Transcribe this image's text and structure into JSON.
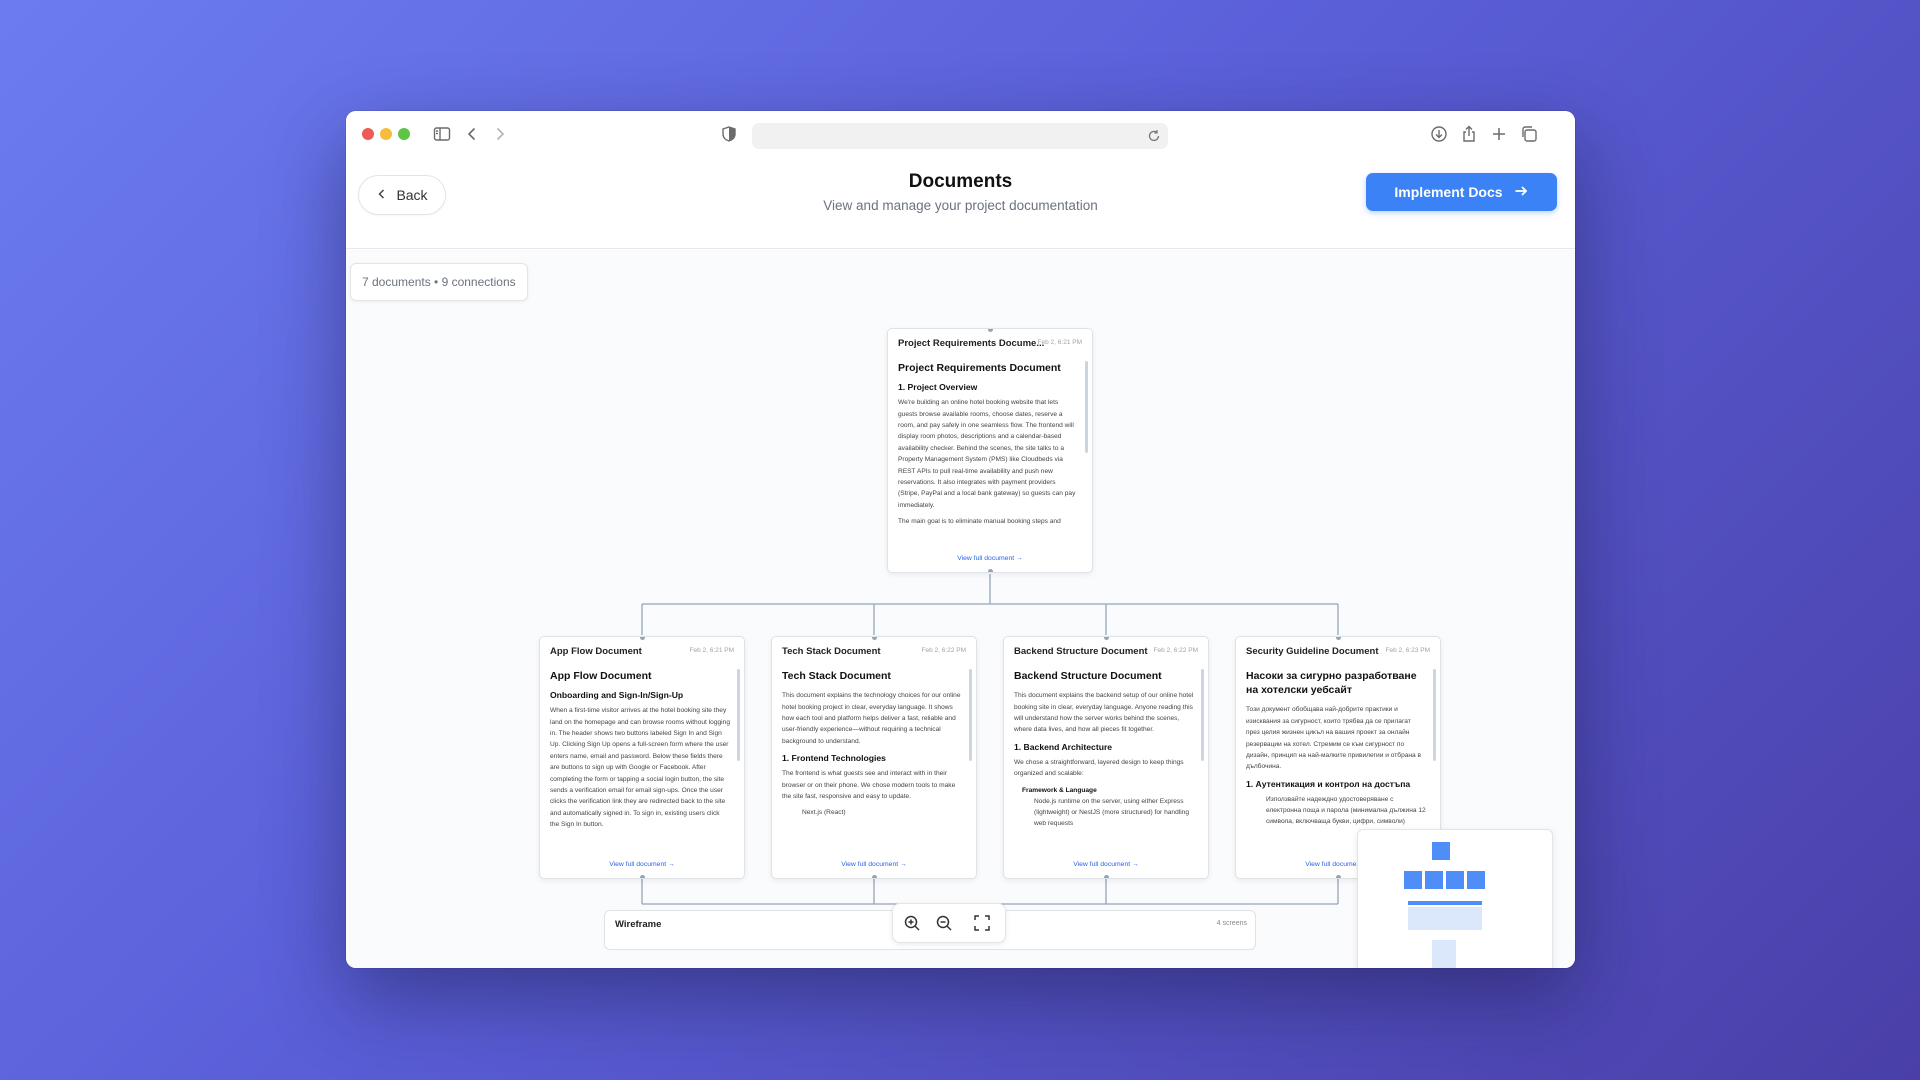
{
  "app": {
    "title": "Documents",
    "subtitle": "View and manage your project documentation",
    "back_label": "Back",
    "implement_label": "Implement Docs"
  },
  "canvas": {
    "stats": "7 documents • 9 connections"
  },
  "documents": [
    {
      "title": "Project Requirements Docume...",
      "date": "Feb 2, 6:21 PM",
      "heading": "Project Requirements Document",
      "section": "1. Project Overview",
      "paragraphs": [
        "We're building an online hotel booking website that lets guests browse available rooms, choose dates, reserve a room, and pay safely in one seamless flow. The frontend will display room photos, descriptions and a calendar-based availability checker. Behind the scenes, the site talks to a Property Management System (PMS) like Cloudbeds via REST APIs to pull real-time availability and push new reservations. It also integrates with payment providers (Stripe, PayPal and a local bank gateway) so guests can pay immediately.",
        "The main goal is to eliminate manual booking steps and"
      ],
      "link": "View full document →"
    },
    {
      "title": "App Flow Document",
      "date": "Feb 2, 6:21 PM",
      "heading": "App Flow Document",
      "section": "Onboarding and Sign-In/Sign-Up",
      "paragraphs": [
        "When a first-time visitor arrives at the hotel booking site they land on the homepage and can browse rooms without logging in. The header shows two buttons labeled Sign In and Sign Up. Clicking Sign Up opens a full-screen form where the user enters name, email and password. Below these fields there are buttons to sign up with Google or Facebook. After completing the form or tapping a social login button, the site sends a verification email for email sign-ups. Once the user clicks the verification link they are redirected back to the site and automatically signed in. To sign in, existing users click the Sign In button."
      ],
      "link": "View full document →"
    },
    {
      "title": "Tech Stack Document",
      "date": "Feb 2, 6:22 PM",
      "heading": "Tech Stack Document",
      "paragraphs": [
        "This document explains the technology choices for our online hotel booking project in clear, everyday language. It shows how each tool and platform helps deliver a fast, reliable and user-friendly experience—without requiring a technical background to understand."
      ],
      "section": "1. Frontend Technologies",
      "paragraphs2": [
        "The frontend is what guests see and interact with in their browser or on their phone. We chose modern tools to make the site fast, responsive and easy to update."
      ],
      "list": [
        "Next.js (React)"
      ],
      "link": "View full document →"
    },
    {
      "title": "Backend Structure Document",
      "date": "Feb 2, 6:22 PM",
      "heading": "Backend Structure Document",
      "paragraphs": [
        "This document explains the backend setup of our online hotel booking site in clear, everyday language. Anyone reading this will understand how the server works behind the scenes, where data lives, and how all pieces fit together."
      ],
      "section": "1. Backend Architecture",
      "paragraphs2": [
        "We chose a straightforward, layered design to keep things organized and scalable:"
      ],
      "list_bold": "Framework & Language",
      "list_sub": "Node.js runtime on the server, using either Express (lightweight) or NestJS (more structured) for handling web requests",
      "link": "View full document →"
    },
    {
      "title": "Security Guideline Document",
      "date": "Feb 2, 6:23 PM",
      "heading": "Насоки за сигурно разработване на хотелски уебсайт",
      "paragraphs": [
        "Този документ обобщава най-добрите практики и изисквания за сигурност, които трябва да се прилагат през целия жизнен цикъл на вашия проект за онлайн резервации на хотел. Стремим се към сигурност по дизайн, принцип на най-малките привилегии и отбрана в дълбочина."
      ],
      "section": "1. Аутентикация и контрол на достъпа",
      "list_sub": "Използвайте надеждно удостоверяване с електронна поща и парола (минимална дължина 12 символа, включваща букви, цифри, символи)",
      "link": "View full document →"
    }
  ],
  "wireframe": {
    "title": "Wireframe",
    "count": "4 screens"
  },
  "colors": {
    "accent": "#3b82f6",
    "link": "#2563eb",
    "connector": "#94a3b8"
  },
  "icons": {
    "zoom_in": "zoom-in-icon",
    "zoom_out": "zoom-out-icon",
    "fullscreen": "fullscreen-icon"
  }
}
